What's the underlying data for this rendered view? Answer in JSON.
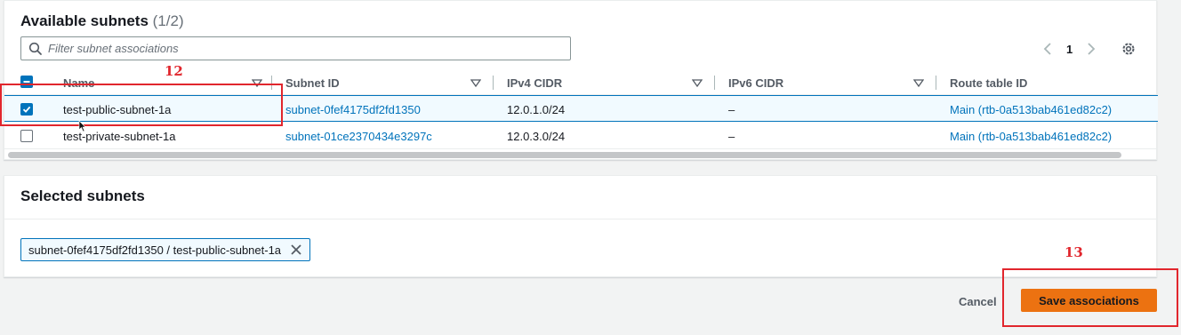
{
  "available": {
    "title": "Available subnets",
    "count": "(1/2)",
    "filter_placeholder": "Filter subnet associations",
    "filter_value": "",
    "page": "1",
    "columns": [
      "Name",
      "Subnet ID",
      "IPv4 CIDR",
      "IPv6 CIDR",
      "Route table ID"
    ],
    "rows": [
      {
        "name": "test-public-subnet-1a",
        "subnet_id": "subnet-0fef4175df2fd1350",
        "ipv4": "12.0.1.0/24",
        "ipv6": "–",
        "route_table": "Main (rtb-0a513bab461ed82c2)",
        "checked": true
      },
      {
        "name": "test-private-subnet-1a",
        "subnet_id": "subnet-01ce2370434e3297c",
        "ipv4": "12.0.3.0/24",
        "ipv6": "–",
        "route_table": "Main (rtb-0a513bab461ed82c2)",
        "checked": false
      }
    ]
  },
  "selected": {
    "title": "Selected subnets",
    "token": "subnet-0fef4175df2fd1350 / test-public-subnet-1a"
  },
  "actions": {
    "cancel": "Cancel",
    "save": "Save associations"
  },
  "annotations": {
    "step_12": "12",
    "step_13": "13"
  },
  "colors": {
    "accent": "#0073bb",
    "primary_button": "#ec7211",
    "annotation": "#e1262d"
  },
  "icons": [
    "search-icon",
    "chevron-left-icon",
    "chevron-right-icon",
    "gear-icon",
    "sort-icon",
    "checkbox-icon",
    "close-icon",
    "cursor-icon"
  ]
}
